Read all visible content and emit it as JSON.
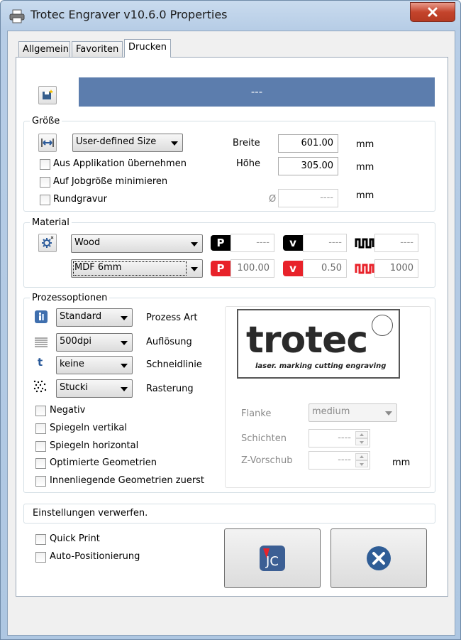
{
  "window": {
    "title": "Trotec Engraver v10.6.0 Properties"
  },
  "tabs": [
    {
      "label": "Allgemein"
    },
    {
      "label": "Favoriten"
    },
    {
      "label": "Drucken"
    }
  ],
  "header_bar": {
    "text": "---",
    "color": "#5c7dad"
  },
  "size": {
    "group_label": "Größe",
    "preset": "User-defined Size",
    "from_app": "Aus Applikation übernehmen",
    "minimize": "Auf Jobgröße minimieren",
    "rotary": "Rundgravur",
    "width_label": "Breite",
    "width_value": "601.00",
    "height_label": "Höhe",
    "height_value": "305.00",
    "diameter_symbol": "Ø",
    "diameter_value": "----",
    "unit": "mm"
  },
  "material": {
    "group_label": "Material",
    "material": "Wood",
    "thickness": "MDF 6mm",
    "row1": {
      "p": "----",
      "v": "----",
      "f": "----"
    },
    "row2": {
      "p": "100.00",
      "v": "0.50",
      "f": "1000"
    },
    "letters": {
      "p": "P",
      "v": "v"
    }
  },
  "process": {
    "group_label": "Prozessoptionen",
    "process_type": "Standard",
    "process_type_label": "Prozess Art",
    "resolution": "500dpi",
    "resolution_label": "Auflösung",
    "cutline": "keine",
    "cutline_label": "Schneidlinie",
    "dither": "Stucki",
    "dither_label": "Rasterung",
    "options": [
      "Negativ",
      "Spiegeln vertikal",
      "Spiegeln horizontal",
      "Optimierte Geometrien",
      "Innenliegende Geometrien zuerst"
    ],
    "flank_label": "Flanke",
    "flank_value": "medium",
    "layers_label": "Schichten",
    "layers_value": "----",
    "z_label": "Z-Vorschub",
    "z_value": "----",
    "z_unit": "mm",
    "icon_letter": "t"
  },
  "logo": {
    "word": "trotec",
    "tagline": "laser. marking cutting engraving"
  },
  "discard": "Einstellungen verwerfen.",
  "quick_print": "Quick Print",
  "auto_position": "Auto-Positionierung",
  "jc_letters": "JC"
}
